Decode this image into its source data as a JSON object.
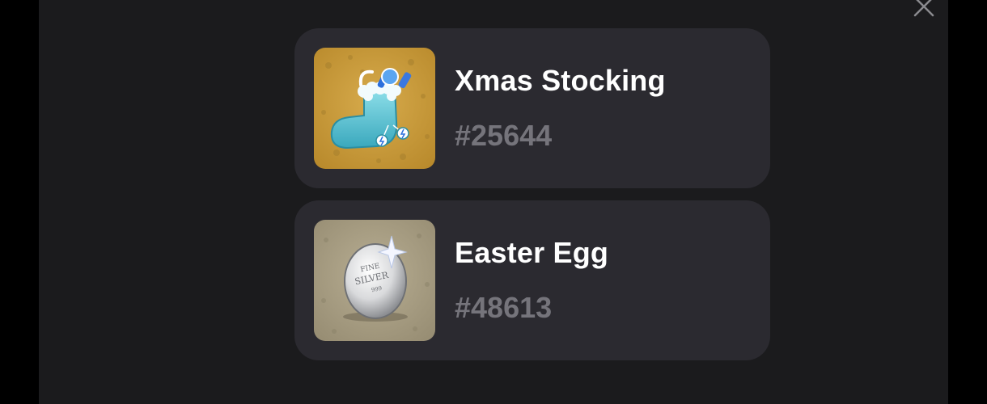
{
  "modal": {
    "close_icon": "close-icon"
  },
  "items": [
    {
      "name": "Xmas Stocking",
      "number": "#25644",
      "image_icon": "xmas-stocking-icon",
      "bg_color": "#c99a3a"
    },
    {
      "name": "Easter Egg",
      "number": "#48613",
      "image_icon": "silver-easter-egg-icon",
      "bg_color": "#a89f86",
      "egg_text": [
        "FINE",
        "SILVER",
        "999"
      ]
    }
  ],
  "colors": {
    "page_bg": "#000000",
    "panel_bg": "#1b1b1d",
    "card_bg": "#2b2a30",
    "title": "#ffffff",
    "subtitle": "#75747b"
  }
}
